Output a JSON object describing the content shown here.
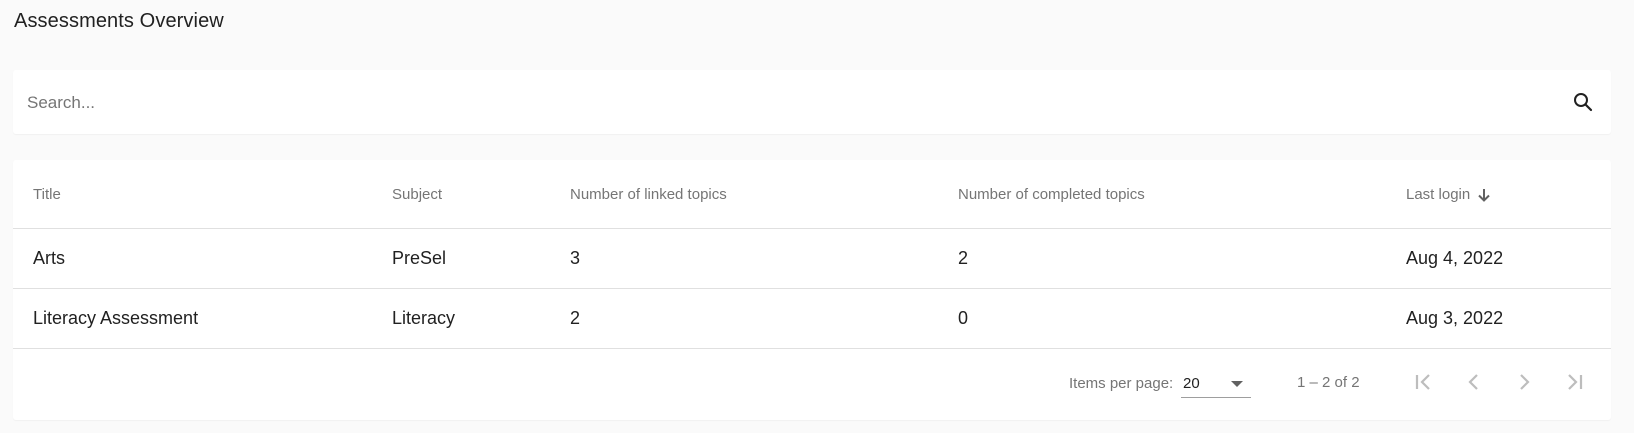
{
  "page": {
    "title": "Assessments Overview"
  },
  "search": {
    "placeholder": "Search...",
    "icon": "search-icon"
  },
  "table": {
    "columns": [
      "Title",
      "Subject",
      "Number of linked topics",
      "Number of completed topics",
      "Last login"
    ],
    "sort": {
      "column": "Last login",
      "direction": "descending",
      "icon": "arrow-down-icon"
    },
    "rows": [
      {
        "title": "Arts",
        "subject": "PreSel",
        "linked_topics": "3",
        "completed_topics": "2",
        "last_login": "Aug 4, 2022"
      },
      {
        "title": "Literacy Assessment",
        "subject": "Literacy",
        "linked_topics": "2",
        "completed_topics": "0",
        "last_login": "Aug 3, 2022"
      }
    ]
  },
  "paginator": {
    "items_per_page_label": "Items per page:",
    "items_per_page_value": "20",
    "range_label": "1 – 2 of 2",
    "icons": [
      "first-page-icon",
      "previous-page-icon",
      "next-page-icon",
      "last-page-icon"
    ]
  },
  "colors": {
    "background": "#fafafa",
    "card": "#ffffff",
    "divider": "#e0e0e0",
    "text_primary": "#212121",
    "text_secondary": "#757575",
    "icon_disabled": "#bdbdbd"
  }
}
